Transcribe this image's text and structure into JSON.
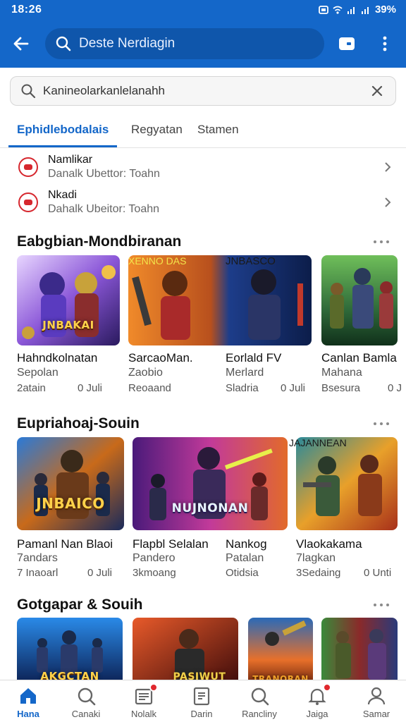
{
  "status": {
    "time": "18:26",
    "battery": "39%"
  },
  "appbar": {
    "search_text": "Deste Nerdiagin"
  },
  "search": {
    "value": "Kanineolarkanlelanahh"
  },
  "tabs": [
    "Ephidlebodalais",
    "Regyatan",
    "Stamen"
  ],
  "list": [
    {
      "name": "Namlikar",
      "sub": "Danalk Ubettor: Toahn"
    },
    {
      "name": "Nkadi",
      "sub": "Dahalk Ubeitor: Toahn"
    }
  ],
  "sections": [
    {
      "title": "Eabgbian-Mondbiranan",
      "cards": [
        {
          "banner": "JNBAKAI",
          "title": "Hahndkolnatan",
          "sub": "Sepolan",
          "meta": "2atain",
          "meta2": "0 Juli"
        },
        {
          "banner": "XENNO DAS",
          "title": "SarcaoMan.",
          "sub": "Zaobio",
          "meta": "Reoaand",
          "meta2": ""
        },
        {
          "banner": "JNBASCO",
          "title": "Eorlald FV",
          "sub": "Merlard",
          "meta": "Sladria",
          "meta2": "0 Juli"
        },
        {
          "banner": "",
          "title": "Canlan Bamla",
          "sub": "Mahana",
          "meta": "Bsesura",
          "meta2": "0 J"
        }
      ]
    },
    {
      "title": "Eupriahoaj-Souin",
      "cards": [
        {
          "banner": "JNBAICO",
          "title": "Pamanl Nan  Blaoi",
          "sub": "7andars",
          "meta": "7 Inaoarl",
          "meta2": "0 Juli"
        },
        {
          "banner": "NUJNONAN",
          "title": "Flapbl Selalan",
          "sub": "Pandero",
          "meta": "3kmoang",
          "meta2": ""
        },
        {
          "banner": "JAJANNEAN",
          "title": "Nankog",
          "sub": "Patalan",
          "meta": "Otidsia",
          "meta2": ""
        },
        {
          "banner": "",
          "title": "Vlaokakama",
          "sub": "7lagkan",
          "meta": "3Sedaing",
          "meta2": "0 Unti"
        }
      ]
    },
    {
      "title": "Gotgapar & Souih",
      "cards": [
        {
          "banner": "AKGCTAN",
          "title": "",
          "sub": "",
          "meta": "",
          "meta2": ""
        },
        {
          "banner": "PASIWUT",
          "title": "",
          "sub": "",
          "meta": "",
          "meta2": ""
        },
        {
          "banner": "TRANORAN",
          "title": "",
          "sub": "",
          "meta": "",
          "meta2": ""
        },
        {
          "banner": "",
          "title": "",
          "sub": "",
          "meta": "",
          "meta2": ""
        }
      ]
    }
  ],
  "nav": [
    {
      "label": "Hana",
      "icon": "home-icon"
    },
    {
      "label": "Canaki",
      "icon": "search-icon"
    },
    {
      "label": "Nolalk",
      "icon": "news-icon"
    },
    {
      "label": "Darin",
      "icon": "document-icon"
    },
    {
      "label": "Rancliny",
      "icon": "search-icon"
    },
    {
      "label": "Jaiga",
      "icon": "bell-icon"
    },
    {
      "label": "Samar",
      "icon": "profile-icon"
    }
  ],
  "colors": {
    "primary": "#1467c9",
    "accent": "#d6272e"
  }
}
